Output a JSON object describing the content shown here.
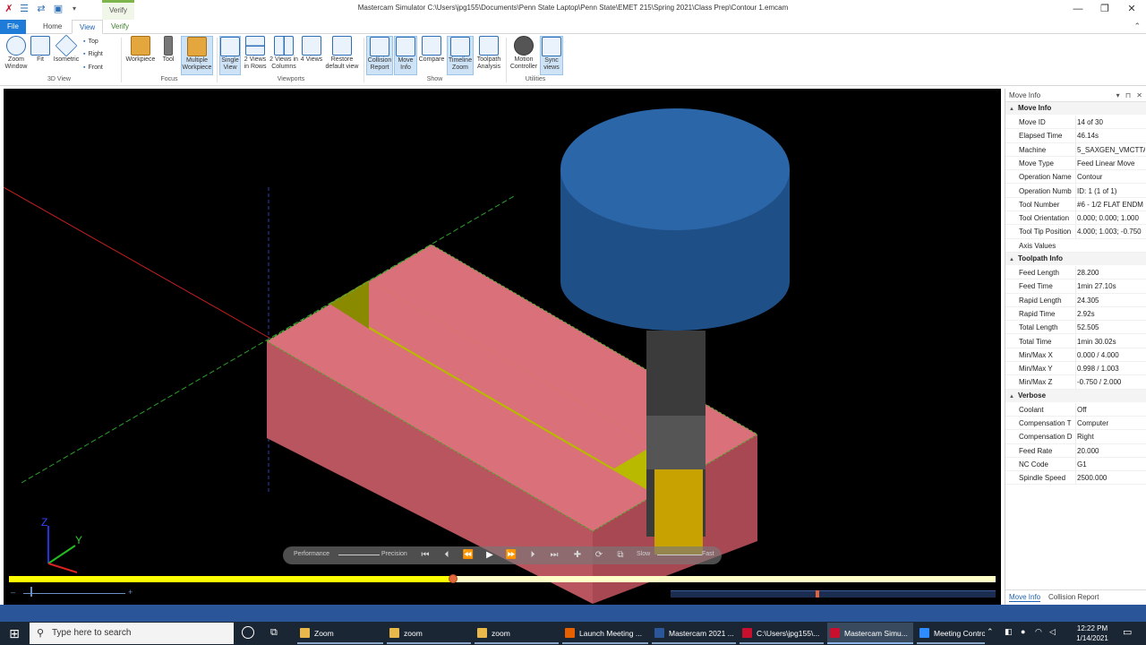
{
  "window": {
    "title": "Mastercam Simulator  C:\\Users\\jpg155\\Documents\\Penn State Laptop\\Penn State\\EMET 215\\Spring 2021\\Class Prep\\Contour 1.emcam",
    "context_tab": "Verify",
    "minimize": "—",
    "restore": "❐",
    "close": "✕"
  },
  "tabs": [
    {
      "label": "File"
    },
    {
      "label": "Home"
    },
    {
      "label": "View"
    },
    {
      "label": "Verify"
    }
  ],
  "ribbon": {
    "groups": [
      {
        "label": "3D View"
      },
      {
        "label": "Focus"
      },
      {
        "label": "Viewports"
      },
      {
        "label": "Show"
      },
      {
        "label": "Utilities"
      }
    ],
    "zoom_window": "Zoom\nWindow",
    "fit": "Fit",
    "isometric": "Isometric",
    "top": "Top",
    "right": "Right",
    "front": "Front",
    "workpiece": "Workpiece",
    "tool": "Tool",
    "multiple_workpiece": "Multiple Workpiece",
    "single_view": "Single View",
    "two_rows": "2 Views in Rows",
    "two_cols": "2 Views in Columns",
    "four_views": "4 Views",
    "restore_default": "Restore default view",
    "collision_report": "Collision Report",
    "move_info": "Move Info",
    "compare": "Compare",
    "timeline_zoom": "Timeline Zoom",
    "toolpath_analysis": "Toolpath Analysis",
    "motion_controller": "Motion Controller",
    "sync_views": "Sync views"
  },
  "viewport": {
    "background": "#000000",
    "stock_color": "#cd6b6b",
    "cut_color": "#b8b800",
    "tool_holder_color": "#1f4f87",
    "axis_labels": {
      "z": "Z",
      "y": "Y"
    },
    "controls": {
      "performance": "Performance",
      "precision": "Precision",
      "slow": "Slow",
      "fast": "Fast"
    },
    "timeline_progress": 0.45,
    "zoom_minus": "–",
    "zoom_plus": "+"
  },
  "panel": {
    "title": "Move Info",
    "sections": [
      {
        "title": "Move Info",
        "rows": [
          {
            "key": "Move ID",
            "value": "14 of 30"
          },
          {
            "key": "Elapsed Time",
            "value": "46.14s"
          },
          {
            "key": "Machine",
            "value": "5_SAXGEN_VMCTTA"
          },
          {
            "key": "Move Type",
            "value": "Feed Linear Move"
          },
          {
            "key": "Operation Name",
            "value": "Contour"
          },
          {
            "key": "Operation Numb",
            "value": "ID: 1 (1 of 1)"
          },
          {
            "key": "Tool Number",
            "value": "#6 - 1/2 FLAT ENDM"
          },
          {
            "key": "Tool Orientation",
            "value": "0.000; 0.000; 1.000"
          },
          {
            "key": "Tool Tip Position",
            "value": "4.000; 1.003; -0.750"
          },
          {
            "key": "Axis Values",
            "value": ""
          }
        ]
      },
      {
        "title": "Toolpath Info",
        "rows": [
          {
            "key": "Feed Length",
            "value": "28.200"
          },
          {
            "key": "Feed Time",
            "value": "1min 27.10s"
          },
          {
            "key": "Rapid Length",
            "value": "24.305"
          },
          {
            "key": "Rapid Time",
            "value": "2.92s"
          },
          {
            "key": "Total Length",
            "value": "52.505"
          },
          {
            "key": "Total Time",
            "value": "1min 30.02s"
          },
          {
            "key": "Min/Max X",
            "value": "0.000 / 4.000"
          },
          {
            "key": "Min/Max Y",
            "value": "0.998 / 1.003"
          },
          {
            "key": "Min/Max Z",
            "value": "-0.750 / 2.000"
          }
        ]
      },
      {
        "title": "Verbose",
        "rows": [
          {
            "key": "Coolant",
            "value": "Off"
          },
          {
            "key": "Compensation T",
            "value": "Computer"
          },
          {
            "key": "Compensation D",
            "value": "Right"
          },
          {
            "key": "Feed Rate",
            "value": "20.000"
          },
          {
            "key": "NC Code",
            "value": "G1"
          },
          {
            "key": "Spindle Speed",
            "value": "2500.000"
          }
        ]
      }
    ],
    "bottom_tabs": [
      "Move Info",
      "Collision Report"
    ]
  },
  "taskbar": {
    "search_placeholder": "Type here to search",
    "items": [
      {
        "label": "Zoom",
        "color": "#e8b84a"
      },
      {
        "label": "zoom",
        "color": "#e8b84a"
      },
      {
        "label": "zoom",
        "color": "#e8b84a"
      },
      {
        "label": "Launch Meeting ...",
        "color": "#e66000"
      },
      {
        "label": "Mastercam 2021 ...",
        "color": "#2b579a"
      },
      {
        "label": "C:\\Users\\jpg155\\...",
        "color": "#c8102e"
      },
      {
        "label": "Mastercam Simu...",
        "color": "#c8102e"
      },
      {
        "label": "Meeting Controls",
        "color": "#2d8cff"
      }
    ],
    "time": "12:22 PM",
    "date": "1/14/2021"
  }
}
